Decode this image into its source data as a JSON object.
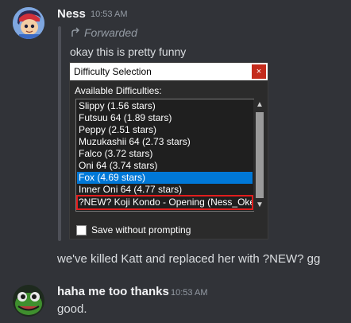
{
  "message1": {
    "username": "Ness",
    "timestamp": "10:53 AM",
    "forwarded_label": "Forwarded",
    "forwarded_text": "okay this is pretty funny",
    "embed": {
      "title": "Difficulty Selection",
      "close": "×",
      "subtitle": "Available Difficulties:",
      "items": [
        "Slippy (1.56 stars)",
        "Futsuu 64 (1.89 stars)",
        "Peppy (2.51 stars)",
        "Muzukashii 64 (2.73 stars)",
        "Falco (3.72 stars)",
        "Oni 64 (3.74 stars)",
        "Fox (4.69 stars)",
        "Inner Oni 64 (4.77 stars)",
        "?NEW? Koji Kondo - Opening (Ness_Okey"
      ],
      "selected_index": 6,
      "highlighted_index": 8,
      "checkbox_label": "Save without prompting",
      "checkbox_checked": false
    },
    "comment": "we've killed Katt and replaced her with ?NEW? gg"
  },
  "message2": {
    "username": "haha me too thanks",
    "timestamp": "10:53 AM",
    "text": "good."
  },
  "colors": {
    "background": "#313338",
    "selection": "#0078d7",
    "highlight_outline": "#e11d1d"
  }
}
